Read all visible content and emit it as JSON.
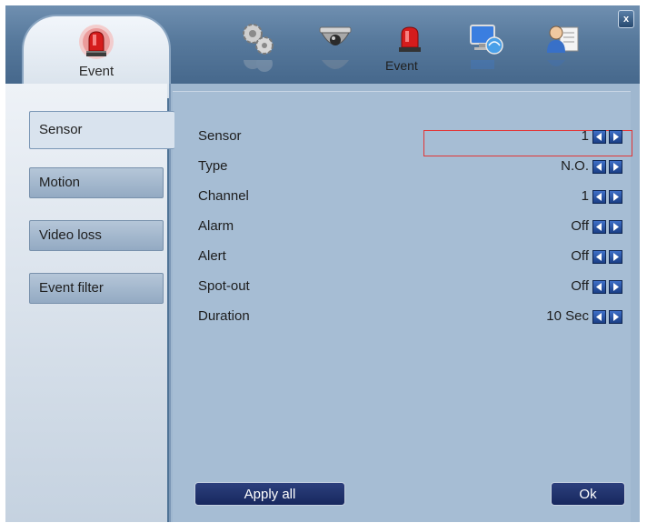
{
  "window": {
    "close_label": "x",
    "active_tab_label": "Event",
    "toolbar_event_label": "Event"
  },
  "toolbar": {
    "icons": [
      "gear-icon",
      "dome-camera-icon",
      "alarm-siren-icon",
      "network-monitor-icon",
      "user-document-icon"
    ]
  },
  "sidebar": {
    "items": [
      {
        "label": "Sensor",
        "active": true
      },
      {
        "label": "Motion",
        "active": false
      },
      {
        "label": "Video loss",
        "active": false
      },
      {
        "label": "Event filter",
        "active": false
      }
    ]
  },
  "settings": {
    "rows": [
      {
        "label": "Sensor",
        "value": "1"
      },
      {
        "label": "Type",
        "value": "N.O."
      },
      {
        "label": "Channel",
        "value": "1"
      },
      {
        "label": "Alarm",
        "value": "Off"
      },
      {
        "label": "Alert",
        "value": "Off"
      },
      {
        "label": "Spot-out",
        "value": "Off"
      },
      {
        "label": "Duration",
        "value": "10 Sec"
      }
    ]
  },
  "buttons": {
    "apply_all": "Apply all",
    "ok": "Ok"
  },
  "colors": {
    "highlight": "#e23636",
    "button_dark": "#17285e",
    "arrow_blue": "#2f5fb5"
  }
}
